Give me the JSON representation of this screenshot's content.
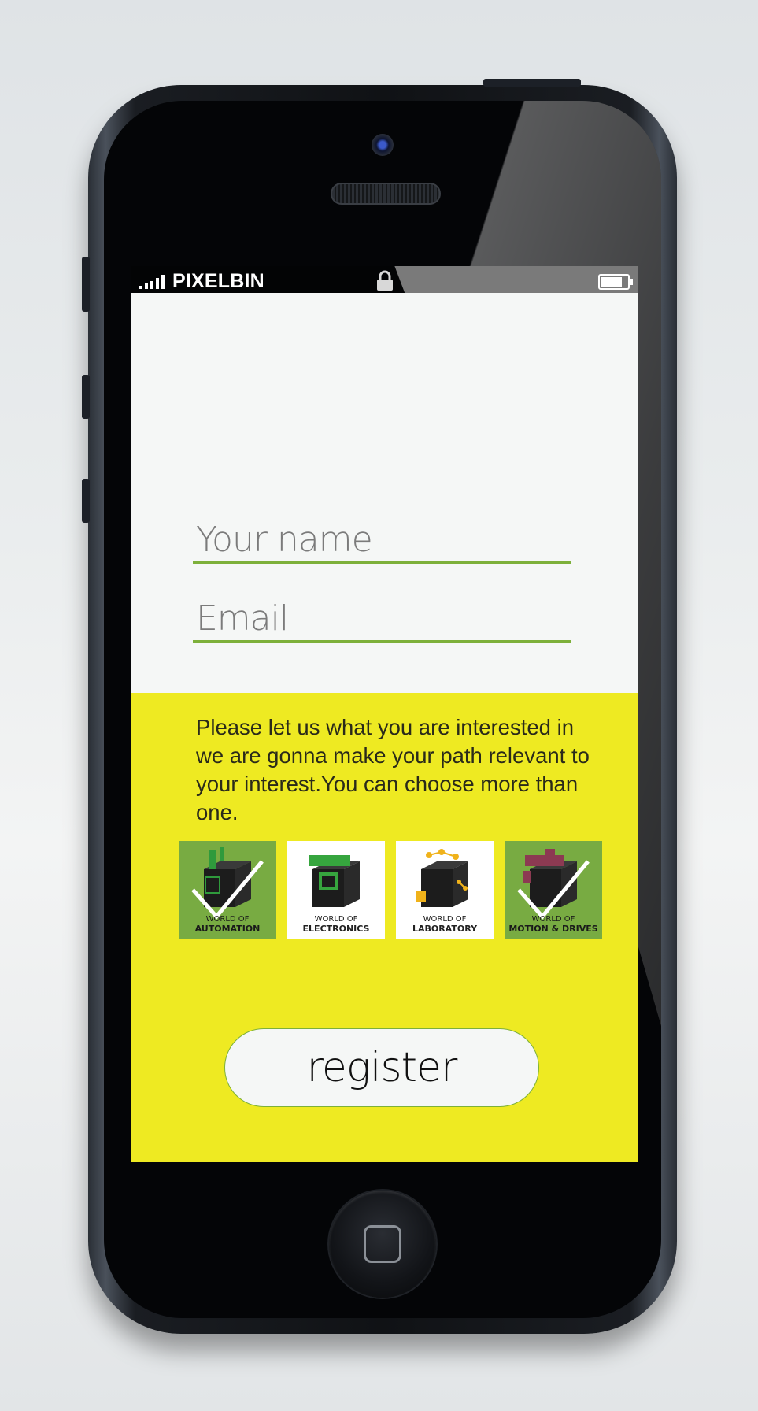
{
  "status_bar": {
    "carrier": "PIXELBIN",
    "signal_icon": "signal-bars-icon",
    "lock_icon": "lock-icon",
    "battery_icon": "battery-icon"
  },
  "form": {
    "name_placeholder": "Your name",
    "email_placeholder": "Email"
  },
  "interests": {
    "description": "Please let us what you are interested in we are gonna make your path relevant to your interest.You can choose more than one.",
    "tiles": [
      {
        "line1": "WORLD OF",
        "line2": "AUTOMATION",
        "selected": true,
        "accent": "#2f9a3c"
      },
      {
        "line1": "WORLD OF",
        "line2": "ELECTRONICS",
        "selected": false,
        "accent": "#36a53e"
      },
      {
        "line1": "WORLD OF",
        "line2": "LABORATORY",
        "selected": false,
        "accent": "#f0b21a"
      },
      {
        "line1": "WORLD OF",
        "line2": "MOTION & DRIVES",
        "selected": true,
        "accent": "#8c3a52"
      }
    ]
  },
  "register_label": "register",
  "colors": {
    "accent_green": "#7db03a",
    "panel_yellow": "#eeea22",
    "selected_tile": "#78ab42"
  }
}
